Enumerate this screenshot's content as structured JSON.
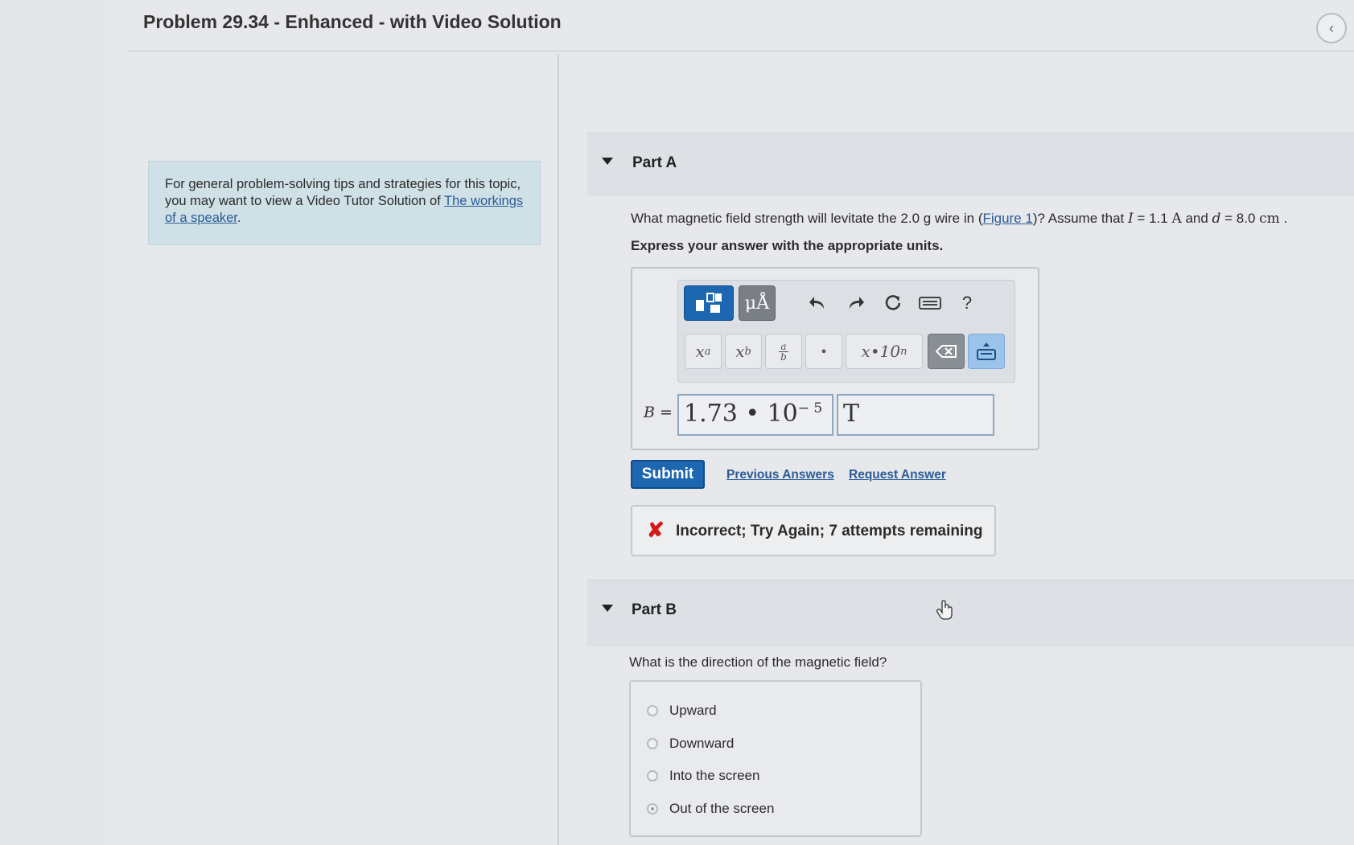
{
  "header": {
    "title": "Problem 29.34 - Enhanced - with Video Solution",
    "back_icon": "‹"
  },
  "tip": {
    "text": "For general problem-solving tips and strategies for this topic, you may want to view a Video Tutor Solution of ",
    "link": "The workings of a speaker",
    "after": "."
  },
  "partA": {
    "title": "Part A",
    "question_pre": "What magnetic field strength will levitate the 2.0 g wire in (",
    "figure_link": "Figure 1",
    "question_mid": ")? Assume that ",
    "I_sym": "I",
    "I_val": " = 1.1 ",
    "I_unit": "A",
    "and": " and ",
    "d_sym": "d",
    "d_val": " = 8.0 ",
    "d_unit": "cm",
    "end": " .",
    "instruction": "Express your answer with the appropriate units.",
    "toolbar": {
      "units_label": "μÅ",
      "question_mark": "?",
      "x_sup": "x",
      "x_sup_exp": "a",
      "x_sub": "x",
      "x_sub_idx": "b",
      "frac_top": "a",
      "frac_bottom": "b",
      "dot": "•",
      "sci_label": "x•10",
      "sci_exp": "n"
    },
    "eq_label": "B =",
    "value_mantissa": "1.73 • 10",
    "value_exp": "− 5",
    "unit_value": "T",
    "submit_label": "Submit",
    "previous_answers": "Previous Answers",
    "request_answer": "Request Answer",
    "feedback_icon": "✘",
    "feedback": "Incorrect; Try Again; 7 attempts remaining"
  },
  "partB": {
    "title": "Part B",
    "question": "What is the direction of the magnetic field?",
    "options": [
      "Upward",
      "Downward",
      "Into the screen",
      "Out of the screen"
    ],
    "selected_index": 3
  }
}
